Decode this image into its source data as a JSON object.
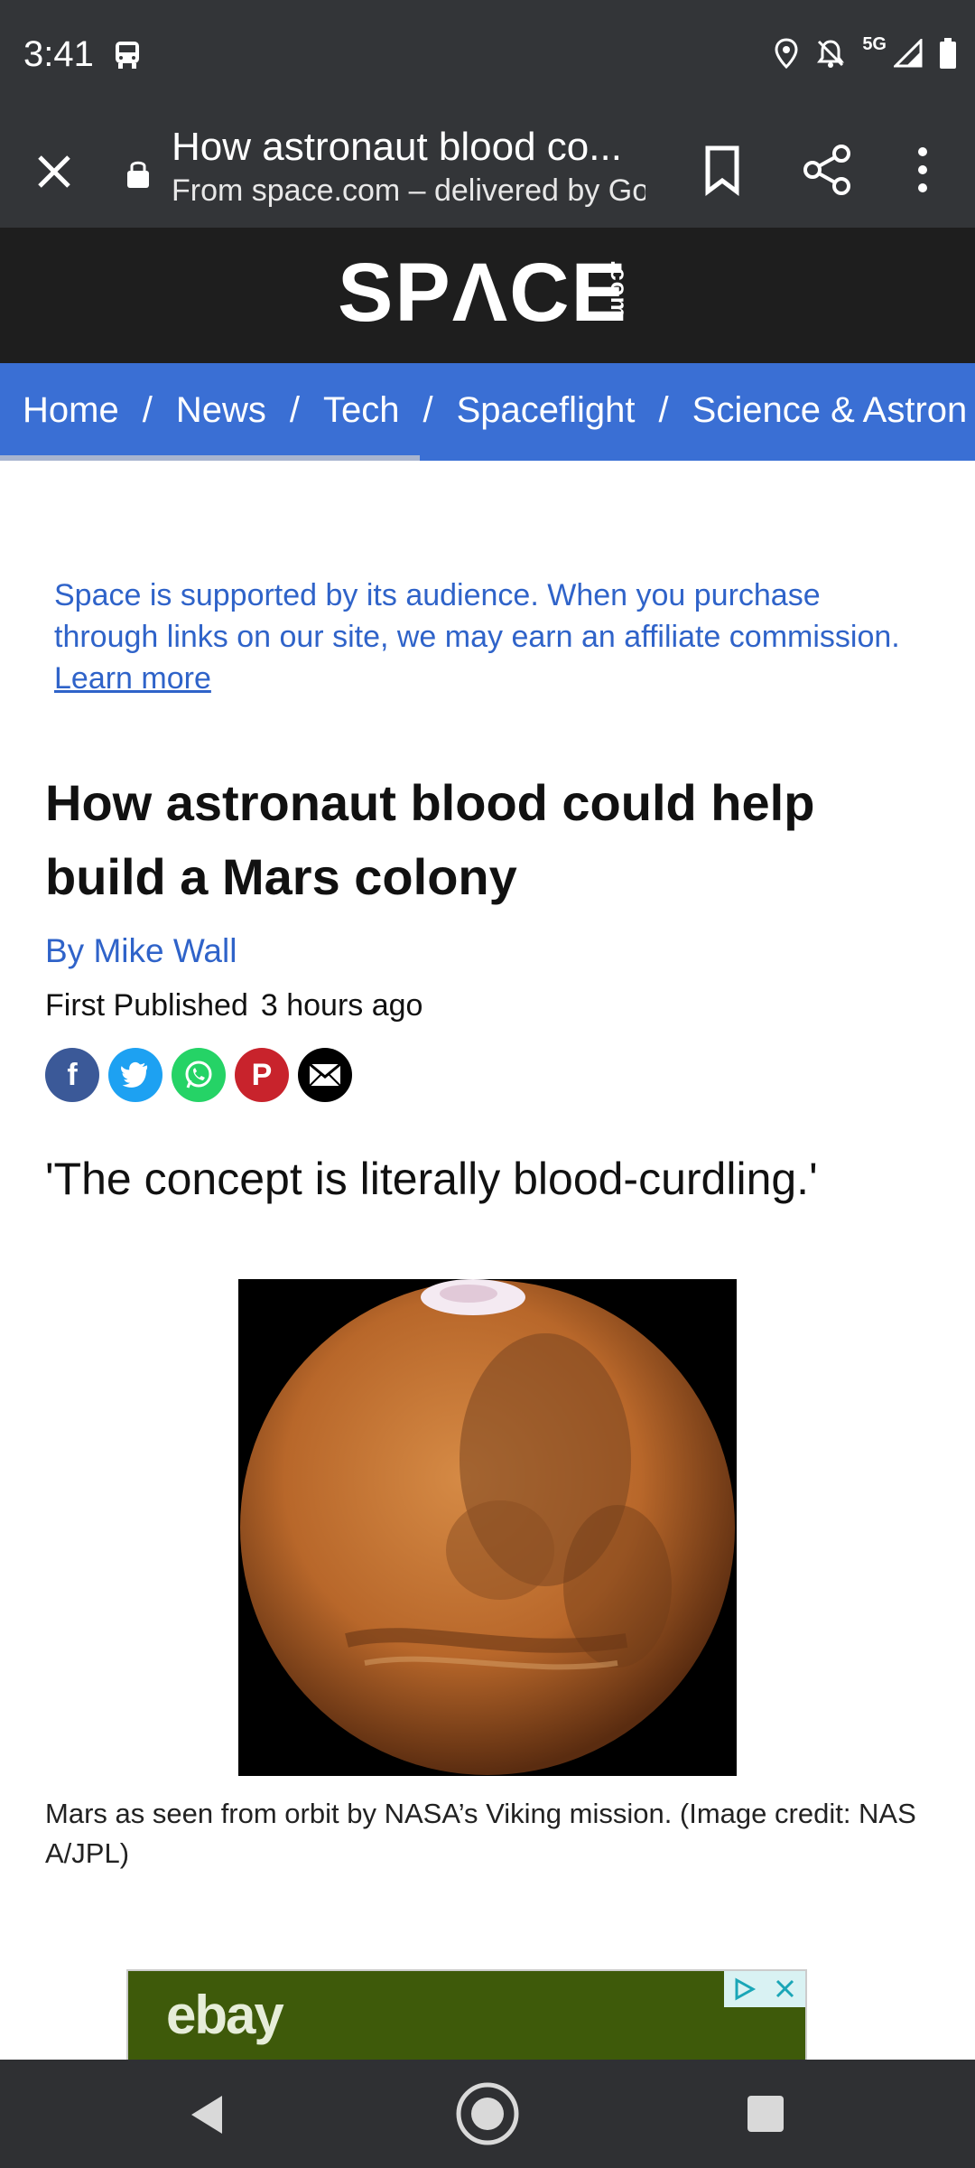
{
  "status_bar": {
    "time": "3:41",
    "network": "5G"
  },
  "toolbar": {
    "title": "How astronaut blood co...",
    "subtitle": "From space.com – delivered by Go"
  },
  "site": {
    "logo_main": "SPΛCE",
    "logo_suffix": ".com"
  },
  "breadcrumb": {
    "items": [
      "Home",
      "News",
      "Tech",
      "Spaceflight",
      "Science & Astron"
    ],
    "separator": "/"
  },
  "affiliate": {
    "text": "Space is supported by its audience. When you purchase through links on our site, we may earn an affiliate commission.",
    "link": "Learn more"
  },
  "article": {
    "title": "How astronaut blood could help build a Mars colony",
    "byline": "By Mike Wall",
    "published_label": "First Published",
    "published_value": "3 hours ago",
    "quote": "'The concept is literally blood-curdling.'",
    "caption": "Mars as seen from orbit by NASA’s Viking mission. (Image credit: NAS A/JPL)"
  },
  "ad": {
    "brand": "ebay"
  },
  "colors": {
    "header": "#1e1e1e",
    "nav": "#3a6fd4",
    "link": "#2f63c9",
    "facebook": "#3b5998",
    "twitter": "#1da1f2",
    "whatsapp": "#25d366",
    "pinterest": "#c8232c",
    "email": "#000000"
  }
}
